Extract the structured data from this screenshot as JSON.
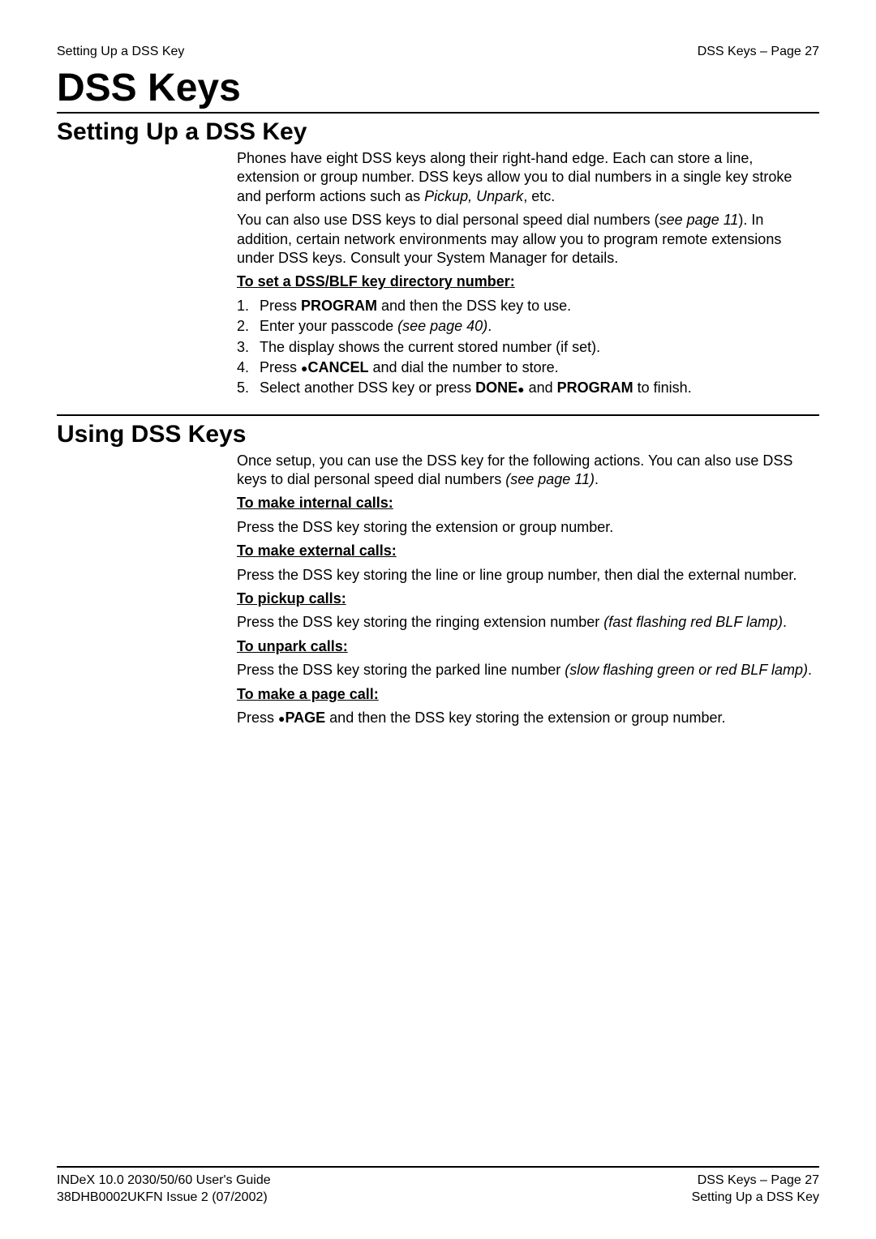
{
  "header": {
    "left": "Setting Up a DSS Key",
    "right": "DSS Keys – Page 27"
  },
  "main_title": "DSS Keys",
  "section1": {
    "title": "Setting Up a DSS Key",
    "para1_a": "Phones have eight DSS keys along their right-hand edge. Each can store a line, extension or group number. DSS keys allow you to dial numbers in a single key stroke and perform actions such as ",
    "para1_italic": "Pickup, Unpark",
    "para1_b": ", etc.",
    "para2_a": "You can also use DSS keys to dial personal speed dial numbers (",
    "para2_italic": "see page 11",
    "para2_b": "). In addition, certain network environments may allow you to program remote extensions under DSS keys. Consult your System Manager for details.",
    "heading": "To set a DSS/BLF key directory number:",
    "steps": {
      "s1_num": "1.",
      "s1_a": "Press ",
      "s1_bold": "PROGRAM",
      "s1_b": " and then the DSS key to use.",
      "s2_num": "2.",
      "s2_a": "Enter your passcode ",
      "s2_italic": "(see page 40)",
      "s2_b": ".",
      "s3_num": "3.",
      "s3_a": "The display shows the current stored number (if set).",
      "s4_num": "4.",
      "s4_a": "Press ",
      "s4_bold": "CANCEL",
      "s4_b": " and dial the number to store.",
      "s5_num": "5.",
      "s5_a": "Select another DSS key or press ",
      "s5_bold1": "DONE",
      "s5_mid": " and ",
      "s5_bold2": "PROGRAM",
      "s5_b": " to finish."
    }
  },
  "section2": {
    "title": "Using DSS Keys",
    "para1_a": "Once setup, you can use the DSS key for the following actions. You can also use DSS keys to dial personal speed dial numbers ",
    "para1_italic": "(see page 11)",
    "para1_b": ".",
    "h1": "To make internal calls:",
    "p1": "Press the DSS key storing the extension or group number.",
    "h2": "To make external calls:",
    "p2": "Press the DSS key storing the line or line group number, then dial the external number.",
    "h3": "To pickup calls:",
    "p3_a": "Press the DSS key storing the ringing extension number ",
    "p3_italic": "(fast flashing red BLF lamp)",
    "p3_b": ".",
    "h4": "To unpark calls:",
    "p4_a": "Press the DSS key storing the parked line number ",
    "p4_italic": "(slow flashing green or red BLF lamp)",
    "p4_b": ".",
    "h5": "To make a page call:",
    "p5_a": "Press ",
    "p5_bold": "PAGE",
    "p5_b": " and then the DSS key storing the extension or group number."
  },
  "footer": {
    "left1": "INDeX 10.0 2030/50/60 User's Guide",
    "left2": "38DHB0002UKFN Issue 2 (07/2002)",
    "right1": "DSS Keys – Page 27",
    "right2": "Setting Up a DSS Key"
  }
}
